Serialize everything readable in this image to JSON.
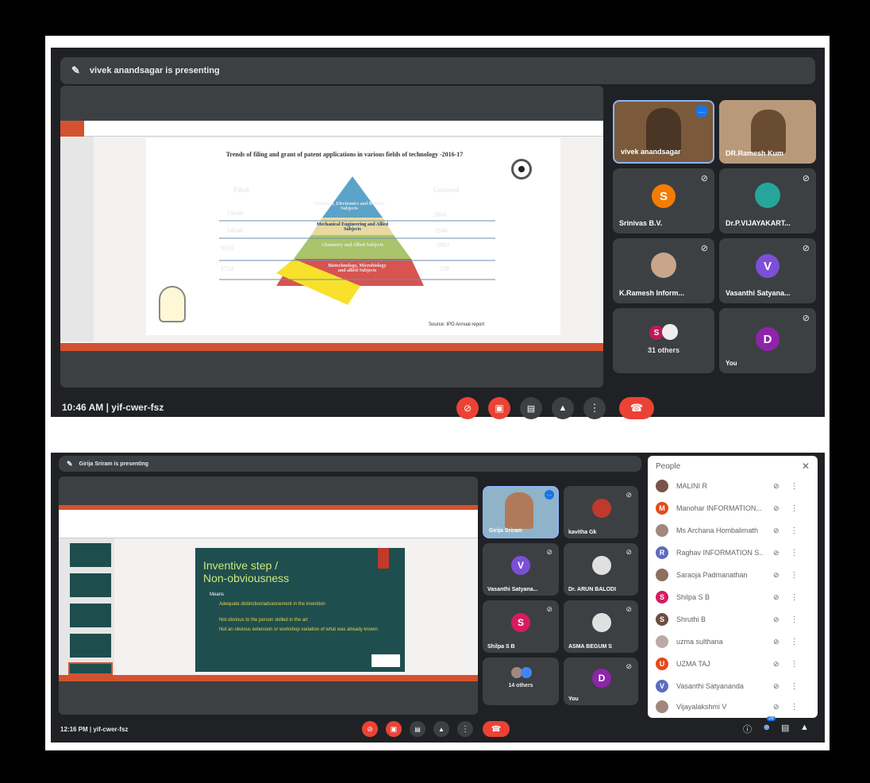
{
  "top": {
    "presenting": "vivek anandsagar is presenting",
    "slide": {
      "title": "Trends of filing and grant of patent applications in various fields of technology -2016-17",
      "filed_header": "Filed",
      "granted_header": "Granted",
      "filed": [
        "19640",
        "14540",
        "9510",
        "1754"
      ],
      "granted": [
        "2860",
        "2546",
        "3883",
        "558"
      ],
      "layers": [
        "Electrical, Electronics and Related Subjects",
        "Mechanical Engineering and Allied Subjects",
        "Chemistry and Allied Subjects",
        "Biotechnology, Microbiology and allied Subjects"
      ],
      "source": "Source: IPO Annual report"
    },
    "tiles": [
      {
        "name": "vivek anandsagar"
      },
      {
        "name": "DR.Ramesh Kum"
      },
      {
        "name": "Srinivas B.V.",
        "initial": "S",
        "color": "#f57c00"
      },
      {
        "name": "Dr.P.VIJAYAKART..."
      },
      {
        "name": "K.Ramesh Inform..."
      },
      {
        "name": "Vasanthi Satyana...",
        "initial": "V",
        "color": "#7b4fd6"
      },
      {
        "name": "31 others",
        "initial": "S",
        "color": "#c2185b"
      },
      {
        "name": "You",
        "initial": "D",
        "color": "#8e24aa"
      }
    ],
    "time": "10:46 AM",
    "code": "yif-cwer-fsz"
  },
  "bottom": {
    "presenting": "Girija Sriram is presenting",
    "slide": {
      "title_line1": "Inventive step /",
      "title_line2": "Non-obviousness",
      "means": "Means",
      "bullets": [
        "Adequate distinction/advancement in the invention",
        "Not obvious to the person skilled in the art",
        "Not an obvious extension or workshop variation of what was already known"
      ]
    },
    "tiles": [
      {
        "name": "Girija Sriram"
      },
      {
        "name": "kavitha Gk"
      },
      {
        "name": "Vasanthi Satyana...",
        "initial": "V",
        "color": "#7b4fd6"
      },
      {
        "name": "Dr. ARUN BALODI"
      },
      {
        "name": "Shilpa S B",
        "initial": "S",
        "color": "#d81b60"
      },
      {
        "name": "ASMA BEGUM S"
      },
      {
        "name": "14 others"
      },
      {
        "name": "You",
        "initial": "D",
        "color": "#8e24aa"
      }
    ],
    "time": "12:16 PM",
    "code": "yif-cwer-fsz",
    "people_title": "People",
    "people_count": "28",
    "people": [
      {
        "name": "MALINI R",
        "color": "#795548",
        "initial": ""
      },
      {
        "name": "Manohar INFORMATION...",
        "color": "#e64a19",
        "initial": "M"
      },
      {
        "name": "Ms Archana Hombalimath",
        "color": "#a1887f",
        "initial": ""
      },
      {
        "name": "Raghav INFORMATION S...",
        "color": "#5c6bc0",
        "initial": "R"
      },
      {
        "name": "Saraoja Padmanathan",
        "color": "#8d6e63",
        "initial": ""
      },
      {
        "name": "Shilpa S B",
        "color": "#d81b60",
        "initial": "S"
      },
      {
        "name": "Shruthi B",
        "color": "#6d4c41",
        "initial": "S"
      },
      {
        "name": "uzma sulthana",
        "color": "#bcaaa4",
        "initial": ""
      },
      {
        "name": "UZMA TAJ",
        "color": "#e64a19",
        "initial": "U"
      },
      {
        "name": "Vasanthi Satyananda",
        "color": "#5c6bc0",
        "initial": "V"
      },
      {
        "name": "Vijayalakshmi V",
        "color": "#a1887f",
        "initial": ""
      }
    ]
  }
}
